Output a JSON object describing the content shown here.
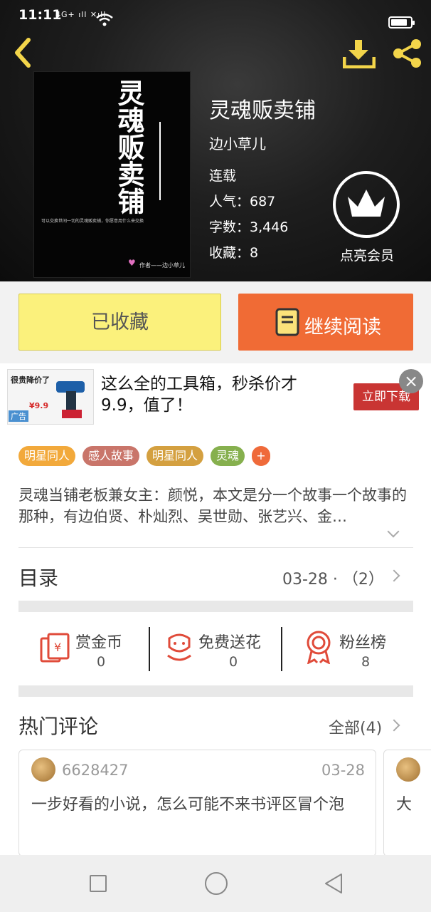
{
  "status_bar": {
    "time": "11:11",
    "network": "4G+ ıll ✕ıll",
    "battery_level": 0.85
  },
  "book": {
    "title": "灵魂贩卖铺",
    "author": "边小草儿",
    "status": "连载",
    "popularity": "人气：687",
    "word_count": "字数：3,446",
    "favorites": "收藏：8",
    "cover": {
      "title": "灵魂贩卖铺",
      "subtitle": "可以交换世间一切的灵魂贩卖铺，你愿意用什么来交换",
      "author": "作者——边小草儿"
    }
  },
  "vip": {
    "label": "点亮会员"
  },
  "actions": {
    "collected_label": "已收藏",
    "continue_label": "继续阅读"
  },
  "ad": {
    "headline": "这么全的工具箱，秒杀价才9.9，值了！",
    "button": "立即下载",
    "product_badge": "很贵降价了",
    "product_price": "¥9.9",
    "tag": "广告"
  },
  "tags": [
    {
      "label": "明星同人",
      "color": "#f2a93b"
    },
    {
      "label": "感人故事",
      "color": "#c9756a"
    },
    {
      "label": "明星同人",
      "color": "#d4a040"
    },
    {
      "label": "灵魂",
      "color": "#86b04e"
    },
    {
      "label": "+",
      "color": "#ef6a3a"
    }
  ],
  "synopsis": "灵魂当铺老板兼女主：颜悦，本文是分一个故事一个故事的那种，有边伯贤、朴灿烈、吴世勋、张艺兴、金…",
  "catalog": {
    "title": "目录",
    "info": "03-28 · （2）"
  },
  "stats": [
    {
      "label": "赏金币",
      "value": "0",
      "icon": "red-envelope-icon"
    },
    {
      "label": "免费送花",
      "value": "0",
      "icon": "flower-icon"
    },
    {
      "label": "粉丝榜",
      "value": "8",
      "icon": "medal-icon"
    }
  ],
  "comments": {
    "title": "热门评论",
    "all_label": "全部(4)",
    "items": [
      {
        "user": "6628427",
        "date": "03-28",
        "text": "一步好看的小说，怎么可能不来书评区冒个泡"
      },
      {
        "user": "",
        "date": "",
        "text": "大"
      }
    ]
  },
  "colors": {
    "accent": "#f06b35",
    "collected": "#fbf17c",
    "icon_gold": "#f3d54a",
    "icon_red": "#e04b3a"
  }
}
